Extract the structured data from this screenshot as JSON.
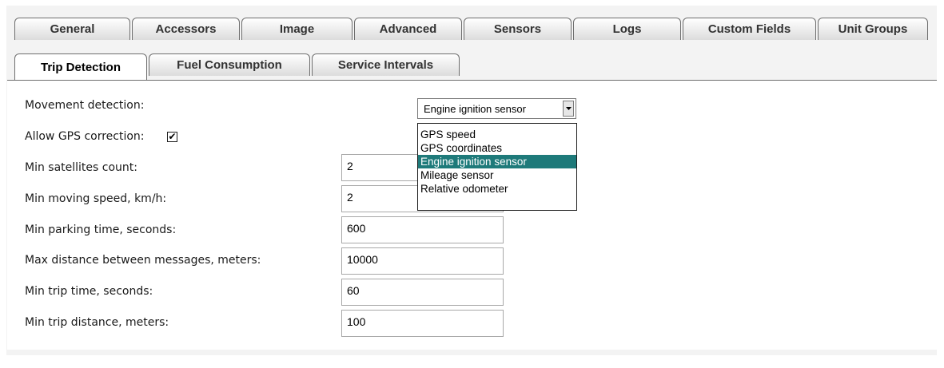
{
  "tabs": [
    {
      "label": "General"
    },
    {
      "label": "Accessors"
    },
    {
      "label": "Image"
    },
    {
      "label": "Advanced"
    },
    {
      "label": "Sensors"
    },
    {
      "label": "Logs"
    },
    {
      "label": "Custom Fields"
    },
    {
      "label": "Unit Groups"
    },
    {
      "label": "Trip Detection"
    },
    {
      "label": "Fuel Consumption"
    },
    {
      "label": "Service Intervals"
    }
  ],
  "active_tab": "Trip Detection",
  "form": {
    "movement_label": "Movement detection:",
    "movement_value": "Engine ignition sensor",
    "gps_correction_label": "Allow GPS correction:",
    "gps_correction_checked": true,
    "check_mark": "✔",
    "min_satellites_label": "Min satellites count:",
    "min_satellites_value": "2",
    "min_speed_label": "Min moving speed, km/h:",
    "min_speed_value": "2",
    "min_parking_label": "Min parking time, seconds:",
    "min_parking_value": "600",
    "max_distance_label": "Max distance between messages, meters:",
    "max_distance_value": "10000",
    "min_trip_time_label": "Min trip time, seconds:",
    "min_trip_time_value": "60",
    "min_trip_distance_label": "Min trip distance, meters:",
    "min_trip_distance_value": "100"
  },
  "dropdown_options": [
    "GPS speed",
    "GPS coordinates",
    "Engine ignition sensor",
    "Mileage sensor",
    "Relative odometer"
  ],
  "selected_option": "Engine ignition sensor",
  "colors": {
    "selected_option_bg": "#1e7a7a",
    "panel_bg": "#f3f3f3"
  }
}
